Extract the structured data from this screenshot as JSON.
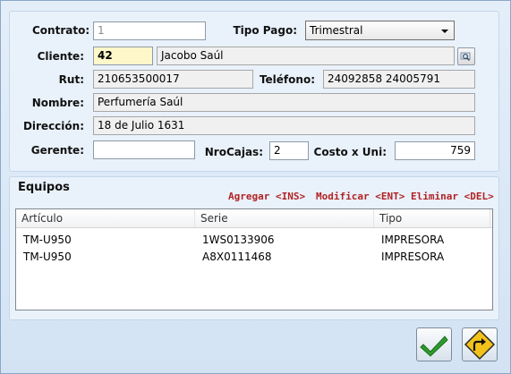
{
  "form": {
    "contrato_label": "Contrato:",
    "contrato_value": "1",
    "tipo_pago_label": "Tipo Pago:",
    "tipo_pago_value": "Trimestral",
    "cliente_label": "Cliente:",
    "cliente_code": "42",
    "cliente_name": "Jacobo Saúl",
    "rut_label": "Rut:",
    "rut_value": "210653500017",
    "telefono_label": "Teléfono:",
    "telefono_value": "24092858 24005791",
    "nombre_label": "Nombre:",
    "nombre_value": "Perfumería Saúl",
    "direccion_label": "Dirección:",
    "direccion_value": "18 de Julio 1631",
    "gerente_label": "Gerente:",
    "gerente_value": "",
    "nrocajas_label": "NroCajas:",
    "nrocajas_value": "2",
    "costo_label": "Costo x Uni:",
    "costo_value": "759"
  },
  "equipos": {
    "title": "Equipos",
    "actions": {
      "agregar": "Agregar <INS>",
      "modificar": "Modificar <ENT>",
      "eliminar": "Eliminar <DEL>"
    },
    "columns": [
      "Artículo",
      "Serie",
      "Tipo"
    ],
    "rows": [
      [
        "TM-U950",
        "1WS0133906",
        "IMPRESORA"
      ],
      [
        "TM-U950",
        "A8X0111468",
        "IMPRESORA"
      ]
    ]
  },
  "icons": {
    "lookup": "magnifier-icon",
    "accept": "check-icon",
    "exit": "turn-arrow-icon"
  },
  "colors": {
    "action_link": "#b22222",
    "highlight_field": "#fdf7c9",
    "accept_green": "#2e9a2e",
    "exit_yellow": "#f2c21b"
  }
}
